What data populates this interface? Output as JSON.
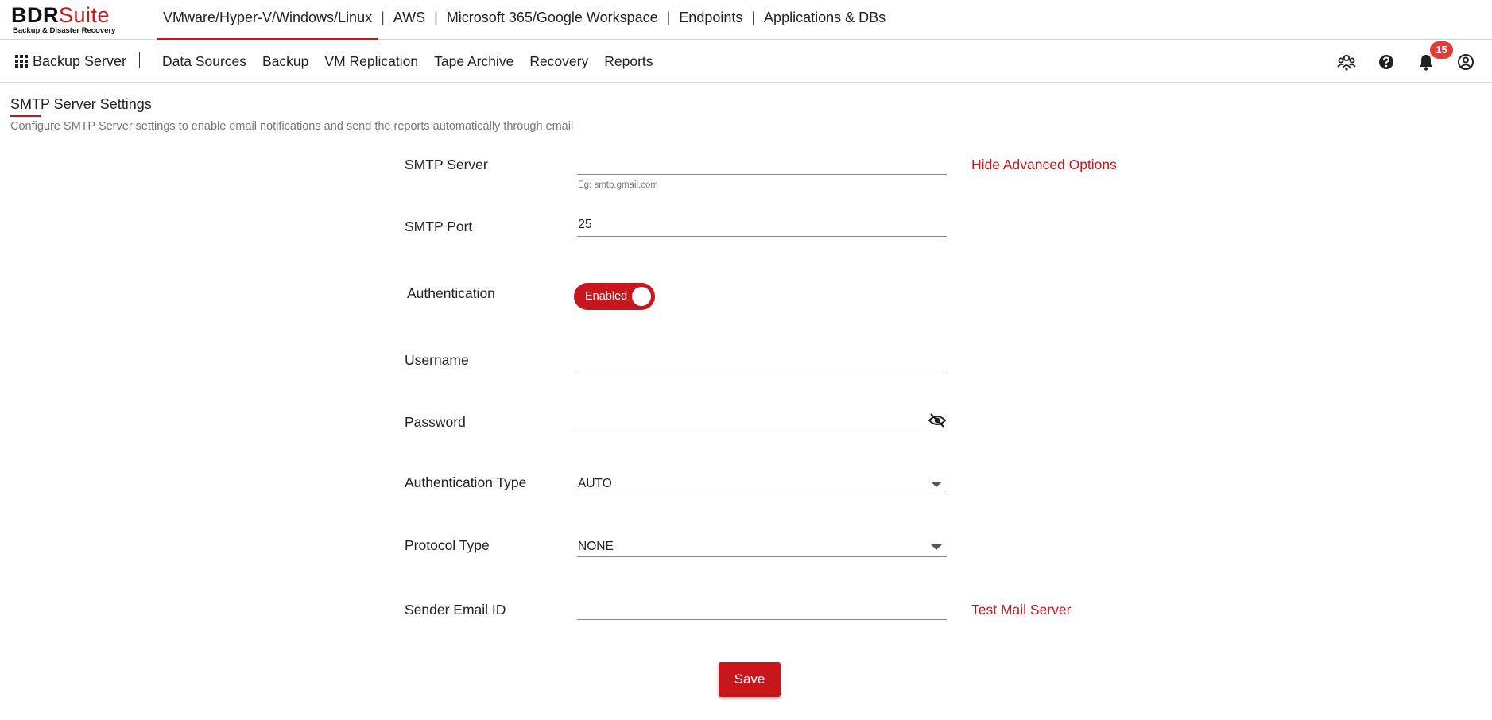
{
  "logo": {
    "brand_main": "BDR",
    "brand_accent": "Suite",
    "tagline": "Backup & Disaster Recovery"
  },
  "top_nav": {
    "items": [
      "VMware/Hyper-V/Windows/Linux",
      "AWS",
      "Microsoft 365/Google Workspace",
      "Endpoints",
      "Applications & DBs"
    ],
    "separator": "|",
    "active_index": 0
  },
  "sub_nav": {
    "apps_label": "Backup Server",
    "items": [
      "Data Sources",
      "Backup",
      "VM Replication",
      "Tape Archive",
      "Recovery",
      "Reports"
    ]
  },
  "toolbar": {
    "icons": [
      "users-network-icon",
      "help-icon",
      "bell-icon",
      "account-icon"
    ],
    "notification_count": "15"
  },
  "page": {
    "title": "SMTP Server Settings",
    "description": "Configure SMTP Server settings to enable email notifications and send the reports automatically through email"
  },
  "form": {
    "smtp_server": {
      "label": "SMTP Server",
      "value": "",
      "hint": "Eg: smtp.gmail.com"
    },
    "advanced_link": "Hide Advanced Options",
    "smtp_port": {
      "label": "SMTP Port",
      "value": "25"
    },
    "authentication": {
      "label": "Authentication",
      "toggle_label": "Enabled",
      "enabled": true
    },
    "username": {
      "label": "Username",
      "value": ""
    },
    "password": {
      "label": "Password",
      "value": ""
    },
    "auth_type": {
      "label": "Authentication Type",
      "value": "AUTO"
    },
    "protocol_type": {
      "label": "Protocol Type",
      "value": "NONE"
    },
    "sender_email": {
      "label": "Sender Email ID",
      "value": ""
    },
    "test_link": "Test Mail Server",
    "save_label": "Save"
  },
  "colors": {
    "accent": "#c8161d",
    "badge": "#e53935",
    "text": "#222222",
    "muted": "#777777"
  }
}
